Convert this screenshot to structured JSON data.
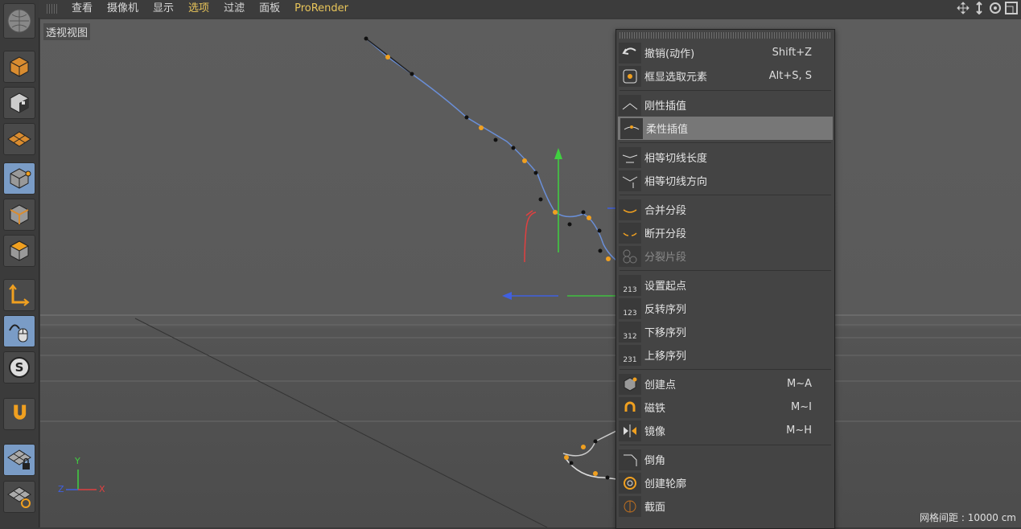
{
  "menubar": {
    "items": [
      "查看",
      "摄像机",
      "显示",
      "选项",
      "过滤",
      "面板",
      "ProRender"
    ]
  },
  "viewport": {
    "label": "透视视图",
    "grid_readout": "网格间距 : 10000 cm",
    "axis_labels": {
      "x": "X",
      "y": "Y",
      "z": "Z"
    }
  },
  "context_menu": {
    "groups": [
      [
        {
          "label": "撤销(动作)",
          "shortcut": "Shift+Z",
          "icon": "undo-icon"
        },
        {
          "label": "框显选取元素",
          "shortcut": "Alt+S, S",
          "icon": "frame-selected-icon"
        }
      ],
      [
        {
          "label": "刚性插值",
          "shortcut": "",
          "icon": "hard-interpolation-icon"
        },
        {
          "label": "柔性插值",
          "shortcut": "",
          "icon": "soft-interpolation-icon",
          "selected": true
        }
      ],
      [
        {
          "label": "相等切线长度",
          "shortcut": "",
          "icon": "equal-tangent-length-icon"
        },
        {
          "label": "相等切线方向",
          "shortcut": "",
          "icon": "equal-tangent-direction-icon"
        }
      ],
      [
        {
          "label": "合并分段",
          "shortcut": "",
          "icon": "join-segment-icon"
        },
        {
          "label": "断开分段",
          "shortcut": "",
          "icon": "break-segment-icon"
        },
        {
          "label": "分裂片段",
          "shortcut": "",
          "icon": "explode-segments-icon",
          "disabled": true
        }
      ],
      [
        {
          "label": "设置起点",
          "shortcut": "",
          "icon": "set-first-point-icon"
        },
        {
          "label": "反转序列",
          "shortcut": "",
          "icon": "reverse-sequence-icon"
        },
        {
          "label": "下移序列",
          "shortcut": "",
          "icon": "move-down-sequence-icon"
        },
        {
          "label": "上移序列",
          "shortcut": "",
          "icon": "move-up-sequence-icon"
        }
      ],
      [
        {
          "label": "创建点",
          "shortcut": "M~A",
          "icon": "create-point-icon"
        },
        {
          "label": "磁铁",
          "shortcut": "M~I",
          "icon": "magnet-icon"
        },
        {
          "label": "镜像",
          "shortcut": "M~H",
          "icon": "mirror-icon"
        }
      ],
      [
        {
          "label": "倒角",
          "shortcut": "",
          "icon": "chamfer-icon"
        },
        {
          "label": "创建轮廓",
          "shortcut": "",
          "icon": "create-outline-icon"
        },
        {
          "label": "截面",
          "shortcut": "",
          "icon": "cross-section-icon"
        }
      ]
    ]
  },
  "toolbar_icons": [
    "undo-globe-icon",
    "model-mode-icon",
    "texture-mode-icon",
    "workplane-mode-icon",
    "points-mode-icon",
    "edges-mode-icon",
    "polygons-mode-icon",
    "axis-mode-icon",
    "tweak-mode-icon",
    "solo-icon",
    "snap-icon",
    "workplane-lock-icon",
    "planar-workplane-icon"
  ],
  "colors": {
    "accent_menu": "#e8c55a",
    "spline": "#6a8fd8",
    "point": "#f0a020",
    "axis_x": "#e04040",
    "axis_y": "#40d040",
    "axis_z": "#4060e0"
  }
}
